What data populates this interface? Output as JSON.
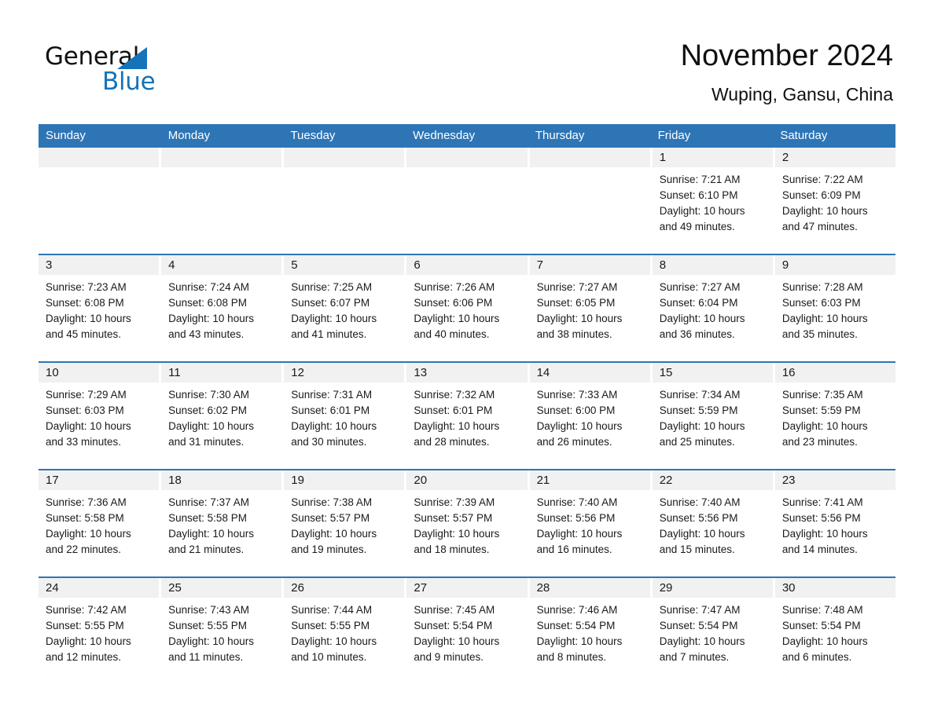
{
  "brand": {
    "name_part1": "General",
    "name_part2": "Blue",
    "triangle_icon": "triangle-icon",
    "accent_color": "#1573b9"
  },
  "header": {
    "title": "November 2024",
    "subtitle": "Wuping, Gansu, China"
  },
  "calendar": {
    "header_bg": "#2e75b6",
    "day_band_bg": "#f1f1f1",
    "weekdays": [
      "Sunday",
      "Monday",
      "Tuesday",
      "Wednesday",
      "Thursday",
      "Friday",
      "Saturday"
    ],
    "weeks": [
      [
        {
          "day": "",
          "sunrise": "",
          "sunset": "",
          "daylight_line1": "",
          "daylight_line2": ""
        },
        {
          "day": "",
          "sunrise": "",
          "sunset": "",
          "daylight_line1": "",
          "daylight_line2": ""
        },
        {
          "day": "",
          "sunrise": "",
          "sunset": "",
          "daylight_line1": "",
          "daylight_line2": ""
        },
        {
          "day": "",
          "sunrise": "",
          "sunset": "",
          "daylight_line1": "",
          "daylight_line2": ""
        },
        {
          "day": "",
          "sunrise": "",
          "sunset": "",
          "daylight_line1": "",
          "daylight_line2": ""
        },
        {
          "day": "1",
          "sunrise": "Sunrise: 7:21 AM",
          "sunset": "Sunset: 6:10 PM",
          "daylight_line1": "Daylight: 10 hours",
          "daylight_line2": "and 49 minutes."
        },
        {
          "day": "2",
          "sunrise": "Sunrise: 7:22 AM",
          "sunset": "Sunset: 6:09 PM",
          "daylight_line1": "Daylight: 10 hours",
          "daylight_line2": "and 47 minutes."
        }
      ],
      [
        {
          "day": "3",
          "sunrise": "Sunrise: 7:23 AM",
          "sunset": "Sunset: 6:08 PM",
          "daylight_line1": "Daylight: 10 hours",
          "daylight_line2": "and 45 minutes."
        },
        {
          "day": "4",
          "sunrise": "Sunrise: 7:24 AM",
          "sunset": "Sunset: 6:08 PM",
          "daylight_line1": "Daylight: 10 hours",
          "daylight_line2": "and 43 minutes."
        },
        {
          "day": "5",
          "sunrise": "Sunrise: 7:25 AM",
          "sunset": "Sunset: 6:07 PM",
          "daylight_line1": "Daylight: 10 hours",
          "daylight_line2": "and 41 minutes."
        },
        {
          "day": "6",
          "sunrise": "Sunrise: 7:26 AM",
          "sunset": "Sunset: 6:06 PM",
          "daylight_line1": "Daylight: 10 hours",
          "daylight_line2": "and 40 minutes."
        },
        {
          "day": "7",
          "sunrise": "Sunrise: 7:27 AM",
          "sunset": "Sunset: 6:05 PM",
          "daylight_line1": "Daylight: 10 hours",
          "daylight_line2": "and 38 minutes."
        },
        {
          "day": "8",
          "sunrise": "Sunrise: 7:27 AM",
          "sunset": "Sunset: 6:04 PM",
          "daylight_line1": "Daylight: 10 hours",
          "daylight_line2": "and 36 minutes."
        },
        {
          "day": "9",
          "sunrise": "Sunrise: 7:28 AM",
          "sunset": "Sunset: 6:03 PM",
          "daylight_line1": "Daylight: 10 hours",
          "daylight_line2": "and 35 minutes."
        }
      ],
      [
        {
          "day": "10",
          "sunrise": "Sunrise: 7:29 AM",
          "sunset": "Sunset: 6:03 PM",
          "daylight_line1": "Daylight: 10 hours",
          "daylight_line2": "and 33 minutes."
        },
        {
          "day": "11",
          "sunrise": "Sunrise: 7:30 AM",
          "sunset": "Sunset: 6:02 PM",
          "daylight_line1": "Daylight: 10 hours",
          "daylight_line2": "and 31 minutes."
        },
        {
          "day": "12",
          "sunrise": "Sunrise: 7:31 AM",
          "sunset": "Sunset: 6:01 PM",
          "daylight_line1": "Daylight: 10 hours",
          "daylight_line2": "and 30 minutes."
        },
        {
          "day": "13",
          "sunrise": "Sunrise: 7:32 AM",
          "sunset": "Sunset: 6:01 PM",
          "daylight_line1": "Daylight: 10 hours",
          "daylight_line2": "and 28 minutes."
        },
        {
          "day": "14",
          "sunrise": "Sunrise: 7:33 AM",
          "sunset": "Sunset: 6:00 PM",
          "daylight_line1": "Daylight: 10 hours",
          "daylight_line2": "and 26 minutes."
        },
        {
          "day": "15",
          "sunrise": "Sunrise: 7:34 AM",
          "sunset": "Sunset: 5:59 PM",
          "daylight_line1": "Daylight: 10 hours",
          "daylight_line2": "and 25 minutes."
        },
        {
          "day": "16",
          "sunrise": "Sunrise: 7:35 AM",
          "sunset": "Sunset: 5:59 PM",
          "daylight_line1": "Daylight: 10 hours",
          "daylight_line2": "and 23 minutes."
        }
      ],
      [
        {
          "day": "17",
          "sunrise": "Sunrise: 7:36 AM",
          "sunset": "Sunset: 5:58 PM",
          "daylight_line1": "Daylight: 10 hours",
          "daylight_line2": "and 22 minutes."
        },
        {
          "day": "18",
          "sunrise": "Sunrise: 7:37 AM",
          "sunset": "Sunset: 5:58 PM",
          "daylight_line1": "Daylight: 10 hours",
          "daylight_line2": "and 21 minutes."
        },
        {
          "day": "19",
          "sunrise": "Sunrise: 7:38 AM",
          "sunset": "Sunset: 5:57 PM",
          "daylight_line1": "Daylight: 10 hours",
          "daylight_line2": "and 19 minutes."
        },
        {
          "day": "20",
          "sunrise": "Sunrise: 7:39 AM",
          "sunset": "Sunset: 5:57 PM",
          "daylight_line1": "Daylight: 10 hours",
          "daylight_line2": "and 18 minutes."
        },
        {
          "day": "21",
          "sunrise": "Sunrise: 7:40 AM",
          "sunset": "Sunset: 5:56 PM",
          "daylight_line1": "Daylight: 10 hours",
          "daylight_line2": "and 16 minutes."
        },
        {
          "day": "22",
          "sunrise": "Sunrise: 7:40 AM",
          "sunset": "Sunset: 5:56 PM",
          "daylight_line1": "Daylight: 10 hours",
          "daylight_line2": "and 15 minutes."
        },
        {
          "day": "23",
          "sunrise": "Sunrise: 7:41 AM",
          "sunset": "Sunset: 5:56 PM",
          "daylight_line1": "Daylight: 10 hours",
          "daylight_line2": "and 14 minutes."
        }
      ],
      [
        {
          "day": "24",
          "sunrise": "Sunrise: 7:42 AM",
          "sunset": "Sunset: 5:55 PM",
          "daylight_line1": "Daylight: 10 hours",
          "daylight_line2": "and 12 minutes."
        },
        {
          "day": "25",
          "sunrise": "Sunrise: 7:43 AM",
          "sunset": "Sunset: 5:55 PM",
          "daylight_line1": "Daylight: 10 hours",
          "daylight_line2": "and 11 minutes."
        },
        {
          "day": "26",
          "sunrise": "Sunrise: 7:44 AM",
          "sunset": "Sunset: 5:55 PM",
          "daylight_line1": "Daylight: 10 hours",
          "daylight_line2": "and 10 minutes."
        },
        {
          "day": "27",
          "sunrise": "Sunrise: 7:45 AM",
          "sunset": "Sunset: 5:54 PM",
          "daylight_line1": "Daylight: 10 hours",
          "daylight_line2": "and 9 minutes."
        },
        {
          "day": "28",
          "sunrise": "Sunrise: 7:46 AM",
          "sunset": "Sunset: 5:54 PM",
          "daylight_line1": "Daylight: 10 hours",
          "daylight_line2": "and 8 minutes."
        },
        {
          "day": "29",
          "sunrise": "Sunrise: 7:47 AM",
          "sunset": "Sunset: 5:54 PM",
          "daylight_line1": "Daylight: 10 hours",
          "daylight_line2": "and 7 minutes."
        },
        {
          "day": "30",
          "sunrise": "Sunrise: 7:48 AM",
          "sunset": "Sunset: 5:54 PM",
          "daylight_line1": "Daylight: 10 hours",
          "daylight_line2": "and 6 minutes."
        }
      ]
    ]
  }
}
